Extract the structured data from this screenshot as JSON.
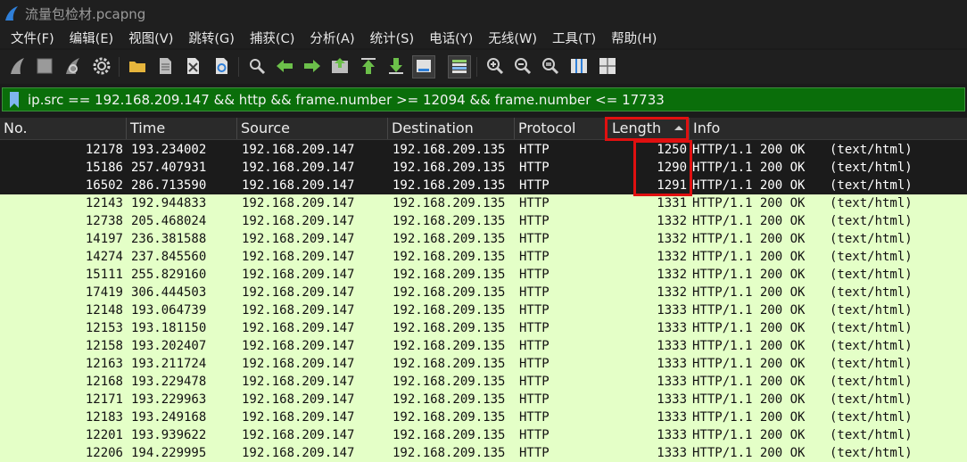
{
  "window": {
    "title": "流量包检材.pcapng",
    "accent": "#2f7fd8"
  },
  "menu": [
    "文件(F)",
    "编辑(E)",
    "视图(V)",
    "跳转(G)",
    "捕获(C)",
    "分析(A)",
    "统计(S)",
    "电话(Y)",
    "无线(W)",
    "工具(T)",
    "帮助(H)"
  ],
  "toolbar": {
    "icons": [
      "shark-fin-start-icon",
      "stop-square-icon",
      "restart-fin-icon",
      "capture-options-gear-icon",
      "open-folder-icon",
      "file-icon",
      "close-file-icon",
      "reload-file-icon",
      "find-magnifier-icon",
      "go-back-arrow-icon",
      "go-forward-arrow-icon",
      "go-to-packet-icon",
      "go-first-arrow-icon",
      "go-last-arrow-icon",
      "autoscroll-icon",
      "colorize-icon",
      "zoom-in-icon",
      "zoom-out-icon",
      "zoom-normal-icon",
      "resize-columns-icon",
      "layout-grid-icon"
    ]
  },
  "filter": {
    "text": "ip.src == 192.168.209.147 && http && frame.number >= 12094 && frame.number <= 17733",
    "bg_color": "#0a6e0a"
  },
  "columns": [
    "No.",
    "Time",
    "Source",
    "Destination",
    "Protocol",
    "Length",
    "Info"
  ],
  "sort": {
    "column": "Length",
    "direction": "ascending"
  },
  "highlight_color": "#e01010",
  "colors": {
    "selected_row_bg": "#1b1b1b",
    "http_row_bg": "#e4ffc7"
  },
  "rows": [
    {
      "no": "12178",
      "time": "193.234002",
      "src": "192.168.209.147",
      "dst": "192.168.209.135",
      "proto": "HTTP",
      "len": "1250",
      "info": "HTTP/1.1 200 OK",
      "ctype": "(text/html)",
      "style": "dark"
    },
    {
      "no": "15186",
      "time": "257.407931",
      "src": "192.168.209.147",
      "dst": "192.168.209.135",
      "proto": "HTTP",
      "len": "1290",
      "info": "HTTP/1.1 200 OK",
      "ctype": "(text/html)",
      "style": "dark"
    },
    {
      "no": "16502",
      "time": "286.713590",
      "src": "192.168.209.147",
      "dst": "192.168.209.135",
      "proto": "HTTP",
      "len": "1291",
      "info": "HTTP/1.1 200 OK",
      "ctype": "(text/html)",
      "style": "dark"
    },
    {
      "no": "12143",
      "time": "192.944833",
      "src": "192.168.209.147",
      "dst": "192.168.209.135",
      "proto": "HTTP",
      "len": "1331",
      "info": "HTTP/1.1 200 OK",
      "ctype": "(text/html)",
      "style": "light"
    },
    {
      "no": "12738",
      "time": "205.468024",
      "src": "192.168.209.147",
      "dst": "192.168.209.135",
      "proto": "HTTP",
      "len": "1332",
      "info": "HTTP/1.1 200 OK",
      "ctype": "(text/html)",
      "style": "light"
    },
    {
      "no": "14197",
      "time": "236.381588",
      "src": "192.168.209.147",
      "dst": "192.168.209.135",
      "proto": "HTTP",
      "len": "1332",
      "info": "HTTP/1.1 200 OK",
      "ctype": "(text/html)",
      "style": "light"
    },
    {
      "no": "14274",
      "time": "237.845560",
      "src": "192.168.209.147",
      "dst": "192.168.209.135",
      "proto": "HTTP",
      "len": "1332",
      "info": "HTTP/1.1 200 OK",
      "ctype": "(text/html)",
      "style": "light"
    },
    {
      "no": "15111",
      "time": "255.829160",
      "src": "192.168.209.147",
      "dst": "192.168.209.135",
      "proto": "HTTP",
      "len": "1332",
      "info": "HTTP/1.1 200 OK",
      "ctype": "(text/html)",
      "style": "light"
    },
    {
      "no": "17419",
      "time": "306.444503",
      "src": "192.168.209.147",
      "dst": "192.168.209.135",
      "proto": "HTTP",
      "len": "1332",
      "info": "HTTP/1.1 200 OK",
      "ctype": "(text/html)",
      "style": "light"
    },
    {
      "no": "12148",
      "time": "193.064739",
      "src": "192.168.209.147",
      "dst": "192.168.209.135",
      "proto": "HTTP",
      "len": "1333",
      "info": "HTTP/1.1 200 OK",
      "ctype": "(text/html)",
      "style": "light"
    },
    {
      "no": "12153",
      "time": "193.181150",
      "src": "192.168.209.147",
      "dst": "192.168.209.135",
      "proto": "HTTP",
      "len": "1333",
      "info": "HTTP/1.1 200 OK",
      "ctype": "(text/html)",
      "style": "light"
    },
    {
      "no": "12158",
      "time": "193.202407",
      "src": "192.168.209.147",
      "dst": "192.168.209.135",
      "proto": "HTTP",
      "len": "1333",
      "info": "HTTP/1.1 200 OK",
      "ctype": "(text/html)",
      "style": "light"
    },
    {
      "no": "12163",
      "time": "193.211724",
      "src": "192.168.209.147",
      "dst": "192.168.209.135",
      "proto": "HTTP",
      "len": "1333",
      "info": "HTTP/1.1 200 OK",
      "ctype": "(text/html)",
      "style": "light"
    },
    {
      "no": "12168",
      "time": "193.229478",
      "src": "192.168.209.147",
      "dst": "192.168.209.135",
      "proto": "HTTP",
      "len": "1333",
      "info": "HTTP/1.1 200 OK",
      "ctype": "(text/html)",
      "style": "light"
    },
    {
      "no": "12171",
      "time": "193.229963",
      "src": "192.168.209.147",
      "dst": "192.168.209.135",
      "proto": "HTTP",
      "len": "1333",
      "info": "HTTP/1.1 200 OK",
      "ctype": "(text/html)",
      "style": "light"
    },
    {
      "no": "12183",
      "time": "193.249168",
      "src": "192.168.209.147",
      "dst": "192.168.209.135",
      "proto": "HTTP",
      "len": "1333",
      "info": "HTTP/1.1 200 OK",
      "ctype": "(text/html)",
      "style": "light"
    },
    {
      "no": "12201",
      "time": "193.939622",
      "src": "192.168.209.147",
      "dst": "192.168.209.135",
      "proto": "HTTP",
      "len": "1333",
      "info": "HTTP/1.1 200 OK",
      "ctype": "(text/html)",
      "style": "light"
    },
    {
      "no": "12206",
      "time": "194.229995",
      "src": "192.168.209.147",
      "dst": "192.168.209.135",
      "proto": "HTTP",
      "len": "1333",
      "info": "HTTP/1.1 200 OK",
      "ctype": "(text/html)",
      "style": "light"
    }
  ]
}
